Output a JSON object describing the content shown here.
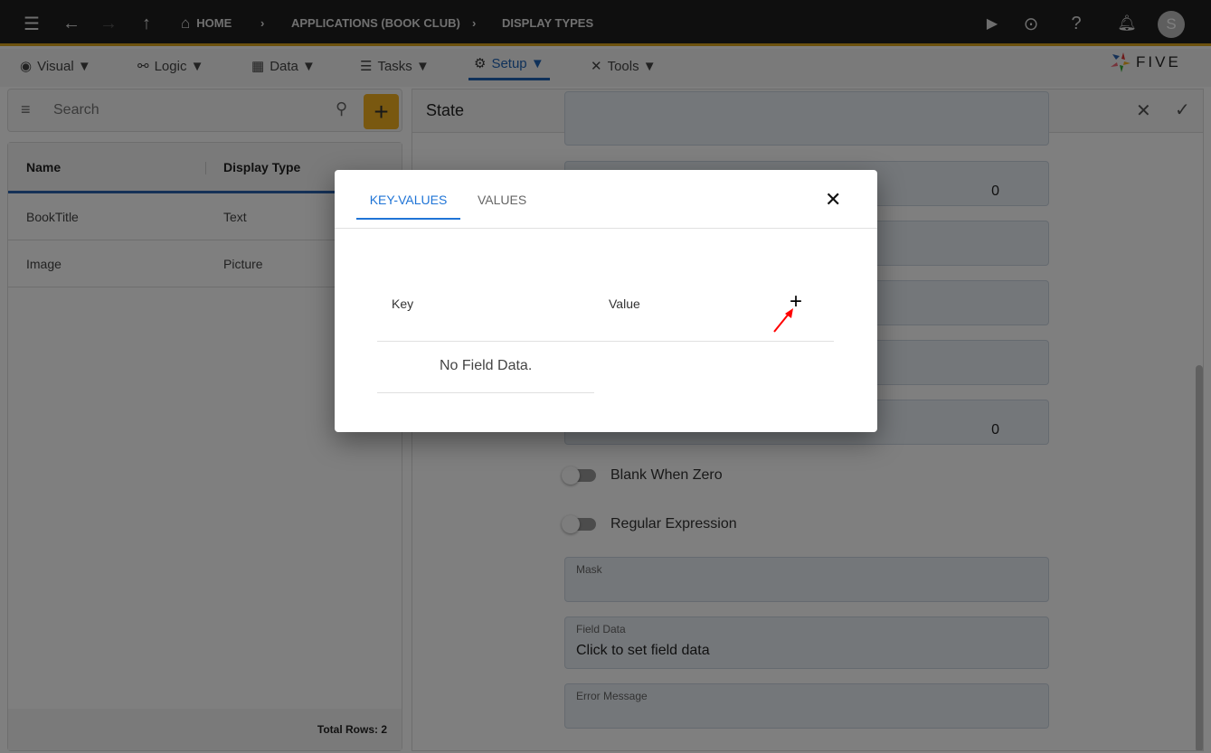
{
  "topbar": {
    "breadcrumbs": [
      "HOME",
      "APPLICATIONS (BOOK CLUB)",
      "DISPLAY TYPES"
    ],
    "avatar_initial": "S",
    "icons": [
      "menu-icon",
      "back-icon",
      "forward-icon",
      "up-icon",
      "home-icon",
      "play-icon",
      "search-play-icon",
      "help-icon",
      "bell-icon"
    ]
  },
  "toolbar": {
    "menus": [
      "Visual ▼",
      "Logic ▼",
      "Data ▼",
      "Tasks ▼",
      "Setup ▼",
      "Tools ▼"
    ],
    "active": "Setup",
    "logo": "FIVE"
  },
  "left": {
    "search_placeholder": "Search",
    "columns": [
      "Name",
      "Display Type"
    ],
    "rows": [
      [
        "BookTitle",
        "Text"
      ],
      [
        "Image",
        "Picture"
      ]
    ],
    "total": "Total Rows: 2"
  },
  "right": {
    "title": "State",
    "fields": {
      "f2_value": "0",
      "f6_value": "0",
      "toggle1": "Blank When Zero",
      "toggle2": "Regular Expression",
      "mask_label": "Mask",
      "field_data_label": "Field Data",
      "field_data_value": "Click to set field data",
      "error_label": "Error Message"
    }
  },
  "modal": {
    "tabs": [
      "KEY-VALUES",
      "VALUES"
    ],
    "active_tab": "KEY-VALUES",
    "col_key": "Key",
    "col_value": "Value",
    "empty": "No Field Data."
  },
  "colors": {
    "accent": "#1f63b5",
    "add_button": "#f2b021",
    "gold_border": "#d9a51f",
    "annotation_arrow": "#ff0000"
  }
}
